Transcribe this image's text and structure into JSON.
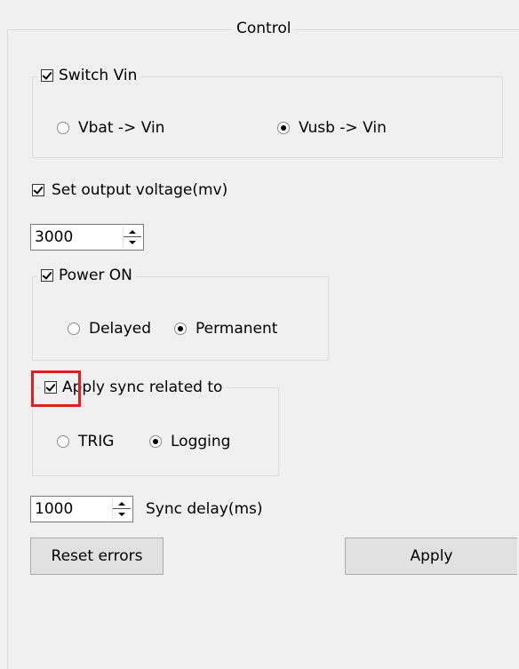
{
  "control": {
    "title": "Control",
    "switch_vin": {
      "label": "Switch Vin",
      "checked": true,
      "options": [
        {
          "label": "Vbat -> Vin",
          "selected": false
        },
        {
          "label": "Vusb -> Vin",
          "selected": true
        }
      ]
    },
    "set_output_voltage": {
      "label": "Set output voltage(mv)",
      "checked": true,
      "value": "3000"
    },
    "power_on": {
      "label": "Power ON",
      "checked": true,
      "options": [
        {
          "label": "Delayed",
          "selected": false
        },
        {
          "label": "Permanent",
          "selected": true
        }
      ]
    },
    "apply_sync": {
      "label": "Apply sync related to",
      "checked": true,
      "highlight_color": "#e02020",
      "options": [
        {
          "label": "TRIG",
          "selected": false
        },
        {
          "label": "Logging",
          "selected": true
        }
      ]
    },
    "sync_delay": {
      "value": "1000",
      "label": "Sync delay(ms)"
    },
    "buttons": {
      "reset_errors": "Reset errors",
      "apply": "Apply"
    }
  }
}
